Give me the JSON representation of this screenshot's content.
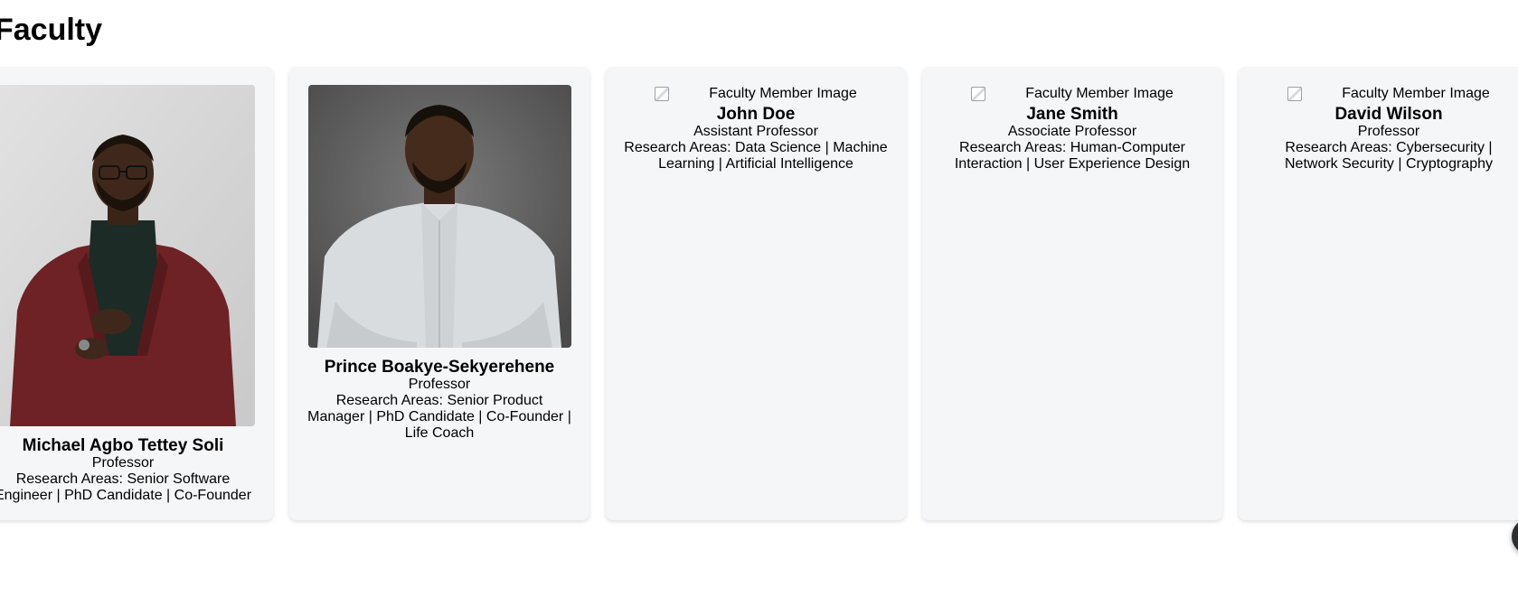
{
  "section": {
    "title": "Faculty"
  },
  "faculty": [
    {
      "name": "Michael Agbo Tettey Soli",
      "title": "Professor",
      "research": "Research Areas: Senior Software Engineer | PhD Candidate | Co-Founder",
      "photo": "portrait-maroon-blazer"
    },
    {
      "name": "Prince Boakye-Sekyerehene",
      "title": "Professor",
      "research": "Research Areas: Senior Product Manager | PhD Candidate | Co-Founder | Life Coach",
      "photo": "portrait-white-shirt"
    },
    {
      "name": "John Doe",
      "title": "Assistant Professor",
      "research": "Research Areas: Data Science | Machine Learning | Artificial Intelligence",
      "image_alt": "Faculty Member Image"
    },
    {
      "name": "Jane Smith",
      "title": "Associate Professor",
      "research": "Research Areas: Human-Computer Interaction | User Experience Design",
      "image_alt": "Faculty Member Image"
    },
    {
      "name": "David Wilson",
      "title": "Professor",
      "research": "Research Areas: Cybersecurity | Network Security | Cryptography",
      "image_alt": "Faculty Member Image"
    }
  ],
  "colors": {
    "card_bg": "#f5f6f8",
    "fab_bg": "#2b2f33"
  },
  "icons": {
    "broken_image": "broken-image-icon",
    "chat": "chat-icon"
  }
}
